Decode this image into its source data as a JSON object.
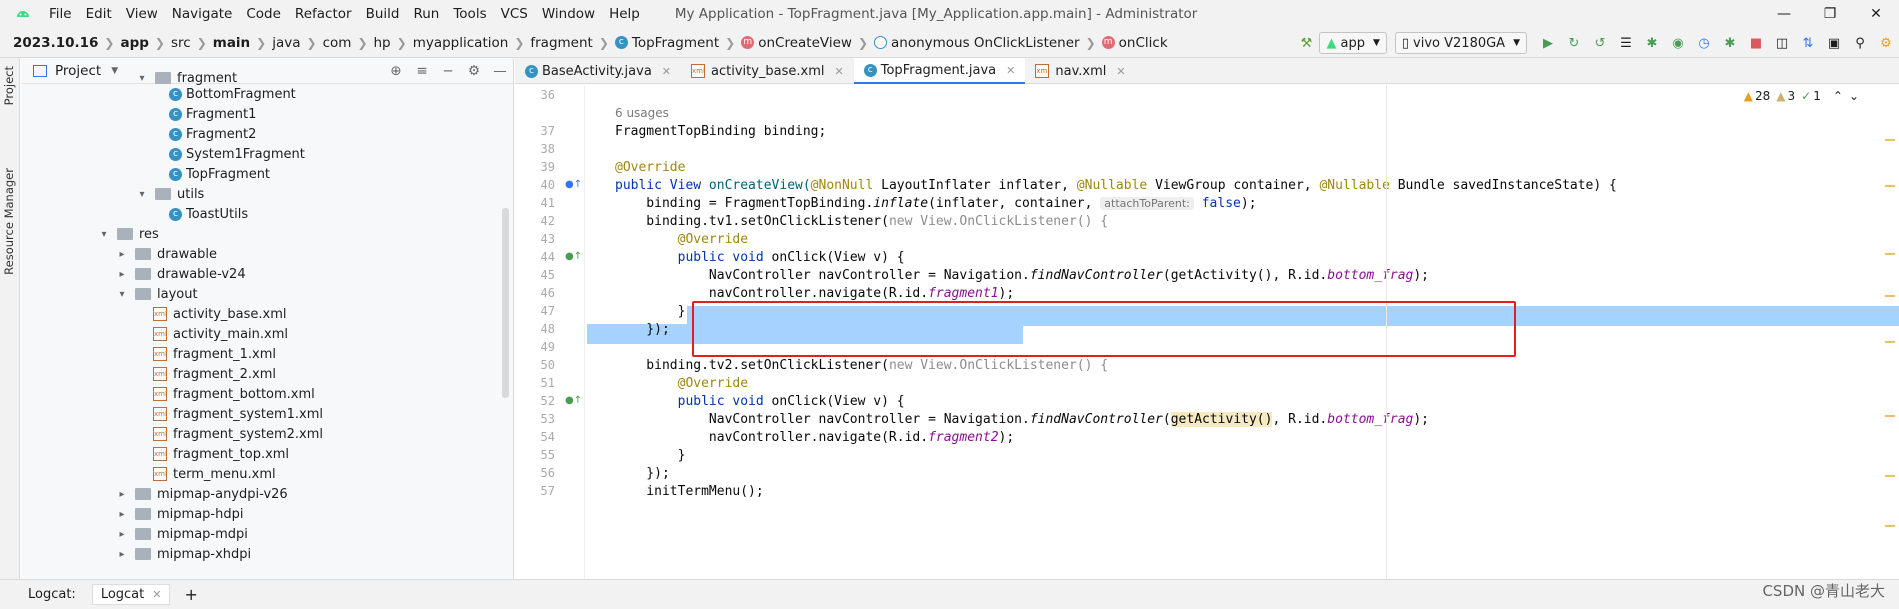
{
  "menubar": {
    "items": [
      "File",
      "Edit",
      "View",
      "Navigate",
      "Code",
      "Refactor",
      "Build",
      "Run",
      "Tools",
      "VCS",
      "Window",
      "Help"
    ],
    "window_title": "My Application - TopFragment.java [My_Application.app.main] - Administrator"
  },
  "navbar": {
    "crumbs": [
      "2023.10.16",
      "app",
      "src",
      "main",
      "java",
      "com",
      "hp",
      "myapplication",
      "fragment",
      "TopFragment",
      "onCreateView",
      "anonymous OnClickListener",
      "onClick"
    ],
    "run_config": "app",
    "device": "vivo V2180GA"
  },
  "left_stripe": {
    "tabs": [
      "Project",
      "Resource Manager"
    ]
  },
  "project_panel": {
    "title": "Project",
    "tree": [
      {
        "label": "fragment",
        "type": "folder"
      },
      {
        "label": "BottomFragment",
        "type": "class"
      },
      {
        "label": "Fragment1",
        "type": "class"
      },
      {
        "label": "Fragment2",
        "type": "class"
      },
      {
        "label": "System1Fragment",
        "type": "class"
      },
      {
        "label": "TopFragment",
        "type": "class"
      },
      {
        "label": "utils",
        "type": "folder"
      },
      {
        "label": "ToastUtils",
        "type": "class"
      },
      {
        "label": "res",
        "type": "folder"
      },
      {
        "label": "drawable",
        "type": "folder"
      },
      {
        "label": "drawable-v24",
        "type": "folder"
      },
      {
        "label": "layout",
        "type": "folder"
      },
      {
        "label": "activity_base.xml",
        "type": "xml"
      },
      {
        "label": "activity_main.xml",
        "type": "xml"
      },
      {
        "label": "fragment_1.xml",
        "type": "xml"
      },
      {
        "label": "fragment_2.xml",
        "type": "xml"
      },
      {
        "label": "fragment_bottom.xml",
        "type": "xml"
      },
      {
        "label": "fragment_system1.xml",
        "type": "xml"
      },
      {
        "label": "fragment_system2.xml",
        "type": "xml"
      },
      {
        "label": "fragment_top.xml",
        "type": "xml"
      },
      {
        "label": "term_menu.xml",
        "type": "xml"
      },
      {
        "label": "mipmap-anydpi-v26",
        "type": "folder"
      },
      {
        "label": "mipmap-hdpi",
        "type": "folder"
      },
      {
        "label": "mipmap-mdpi",
        "type": "folder"
      },
      {
        "label": "mipmap-xhdpi",
        "type": "folder"
      }
    ]
  },
  "editor_tabs": [
    {
      "label": "BaseActivity.java"
    },
    {
      "label": "activity_base.xml"
    },
    {
      "label": "TopFragment.java"
    },
    {
      "label": "nav.xml"
    }
  ],
  "inspections": {
    "warnings": "28",
    "weak": "3",
    "ok": "1"
  },
  "line_numbers": [
    "36",
    "37",
    "38",
    "39",
    "40",
    "41",
    "42",
    "43",
    "44",
    "45",
    "46",
    "47",
    "48",
    "49",
    "50",
    "51",
    "52",
    "53",
    "54",
    "55",
    "56",
    "57"
  ],
  "code": {
    "usages": "6 usages",
    "l37": "FragmentTopBinding binding;",
    "l39": "@Override",
    "l40a": "public View ",
    "l40b": "onCreateView(",
    "l40c": "@NonNull",
    "l40d": " LayoutInflater inflater, ",
    "l40e": "@Nullable",
    "l40f": " ViewGroup container, ",
    "l40g": "@Nullable",
    "l40h": " Bundle savedInstanceState) {",
    "l41a": "    binding = FragmentTopBinding.",
    "l41b": "inflate",
    "l41c": "(inflater, container, ",
    "l41hint": "attachToParent:",
    "l41d": " false",
    "l41e": ");",
    "l42a": "    binding.tv1.setOnClickListener(",
    "l42b": "new View.OnClickListener() {",
    "l43": "        @Override",
    "l44a": "        public void ",
    "l44b": "onClick(View v) {",
    "l45a": "            NavController navController = Navigation.",
    "l45b": "findNavController",
    "l45c": "(getActivity(), R.id.",
    "l45d": "bottom_frag",
    "l45e": ");",
    "l46a": "            navController.navigate(R.id.",
    "l46b": "fragment1",
    "l46c": ");",
    "l47": "        }",
    "l48": "    });",
    "l50a": "    binding.tv2.setOnClickListener(",
    "l50b": "new View.OnClickListener() {",
    "l51": "        @Override",
    "l52a": "        public void ",
    "l52b": "onClick(View v) {",
    "l53a": "            NavController navController = Navigation.",
    "l53b": "findNavController",
    "l53c": "(",
    "l53d": "getActivity()",
    "l53e": ", R.id.",
    "l53f": "bottom_frag",
    "l53g": ");",
    "l54a": "            navController.navigate(R.id.",
    "l54b": "fragment2",
    "l54c": ");",
    "l55": "        }",
    "l56": "    });",
    "l57": "    initTermMenu();"
  },
  "bottom": {
    "logcat1": "Logcat:",
    "logcat2": "Logcat",
    "add": "+"
  },
  "watermark": "CSDN @青山老大",
  "colors": {
    "accent": "#3574f0",
    "selection": "#a6d2ff",
    "annotation": "#9e880d",
    "keyword": "#0033b3",
    "redbox": "#e02020"
  }
}
